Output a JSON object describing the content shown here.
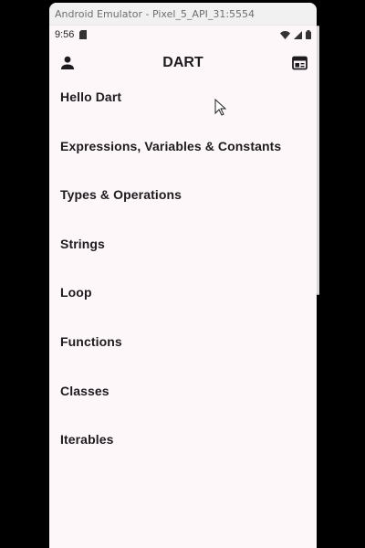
{
  "window": {
    "title": "Android Emulator - Pixel_5_API_31:5554"
  },
  "status_bar": {
    "time": "9:56",
    "icons": [
      "sim-card-icon",
      "wifi-icon",
      "signal-icon",
      "battery-icon"
    ]
  },
  "app_bar": {
    "title": "DART",
    "left_icon": "person-icon",
    "right_icon": "newspaper-icon"
  },
  "topics": [
    {
      "label": "Hello Dart"
    },
    {
      "label": "Expressions, Variables & Constants"
    },
    {
      "label": "Types & Operations"
    },
    {
      "label": "Strings"
    },
    {
      "label": "Loop"
    },
    {
      "label": "Functions"
    },
    {
      "label": "Classes"
    },
    {
      "label": "Iterables"
    }
  ],
  "colors": {
    "background": "#fdf7fa",
    "text": "#1d1b1e",
    "window_chrome": "#f2f1f2"
  }
}
